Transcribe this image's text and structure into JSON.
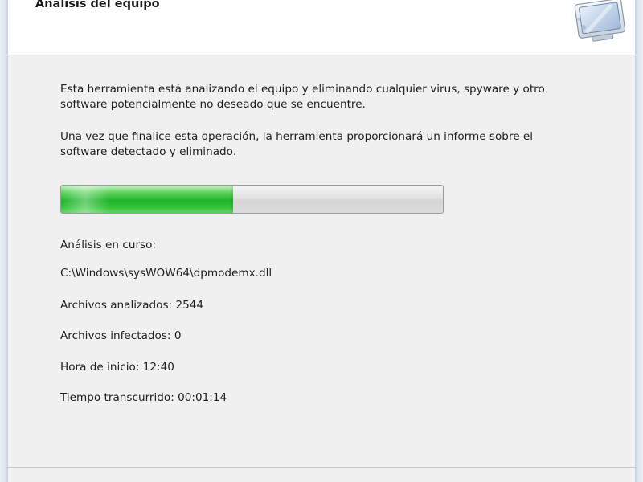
{
  "header": {
    "title": "Análisis del equipo",
    "icon": "computer-scan-icon"
  },
  "main": {
    "description_1": "Esta herramienta está analizando el equipo y eliminando cualquier virus, spyware y otro software potencialmente no deseado que se encuentre.",
    "description_2": "Una vez que finalice esta operación, la herramienta proporcionará un informe sobre el software detectado y eliminado.",
    "progress": {
      "fraction": 0.45,
      "color": "#1fb52a"
    },
    "status": {
      "scanning_label": "Análisis en curso:",
      "current_file": "C:\\Windows\\sysWOW64\\dpmodemx.dll",
      "files_scanned": "Archivos analizados: 2544",
      "files_infected": "Archivos infectados: 0",
      "start_time": "Hora de inicio: 12:40",
      "elapsed_time": "Tiempo transcurrido: 00:01:14"
    }
  }
}
